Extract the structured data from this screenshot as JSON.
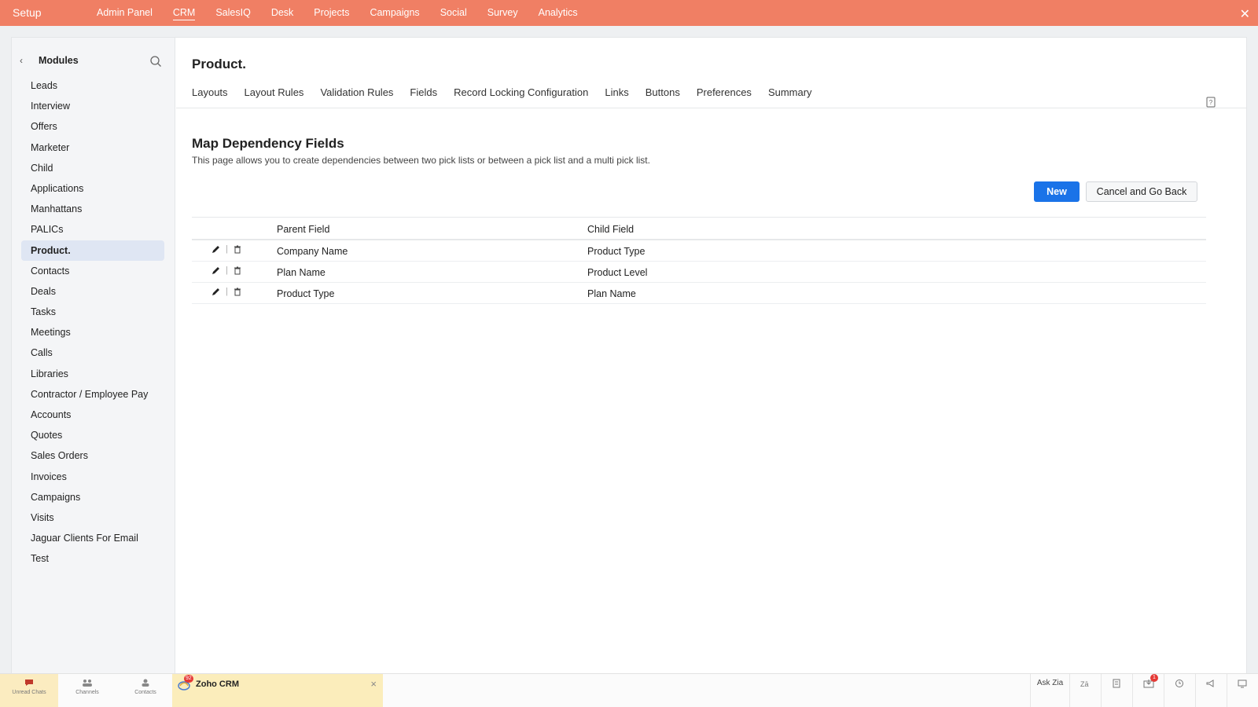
{
  "topbar": {
    "setup": "Setup",
    "nav": [
      "Admin Panel",
      "CRM",
      "SalesIQ",
      "Desk",
      "Projects",
      "Campaigns",
      "Social",
      "Survey",
      "Analytics"
    ],
    "active": "CRM",
    "close": "✕"
  },
  "sidebar": {
    "back": "‹",
    "title": "Modules",
    "items": [
      "Leads",
      "Interview",
      "Offers",
      "Marketer",
      "Child",
      "Applications",
      "Manhattans",
      "PALICs",
      "Product.",
      "Contacts",
      "Deals",
      "Tasks",
      "Meetings",
      "Calls",
      "Libraries",
      "Contractor / Employee Pay",
      "Accounts",
      "Quotes",
      "Sales Orders",
      "Invoices",
      "Campaigns",
      "Visits",
      "Jaguar Clients For Email",
      "Test"
    ],
    "active": "Product."
  },
  "page": {
    "title": "Product.",
    "tabs": [
      "Layouts",
      "Layout Rules",
      "Validation Rules",
      "Fields",
      "Record Locking Configuration",
      "Links",
      "Buttons",
      "Preferences",
      "Summary"
    ]
  },
  "section": {
    "title": "Map Dependency Fields",
    "description": "This page allows you to create dependencies between two pick lists or between a pick list and a multi pick list."
  },
  "buttons": {
    "new": "New",
    "cancel": "Cancel and Go Back"
  },
  "table": {
    "headers": {
      "parent": "Parent Field",
      "child": "Child Field"
    },
    "rows": [
      {
        "parent": "Company Name",
        "child": "Product Type"
      },
      {
        "parent": "Plan Name",
        "child": "Product Level"
      },
      {
        "parent": "Product Type",
        "child": "Plan Name"
      }
    ]
  },
  "taskbar": {
    "unread_chats": "Unread Chats",
    "unread_badge": "",
    "channels": "Channels",
    "contacts": "Contacts",
    "app_tab": "Zoho CRM",
    "app_badge": "92",
    "ask_zia": "Ask Zia",
    "notif_badge": "1"
  },
  "colors": {
    "topbar": "#f07f64",
    "primary": "#1a73e8",
    "active_sidebar": "#dfe6f3"
  }
}
